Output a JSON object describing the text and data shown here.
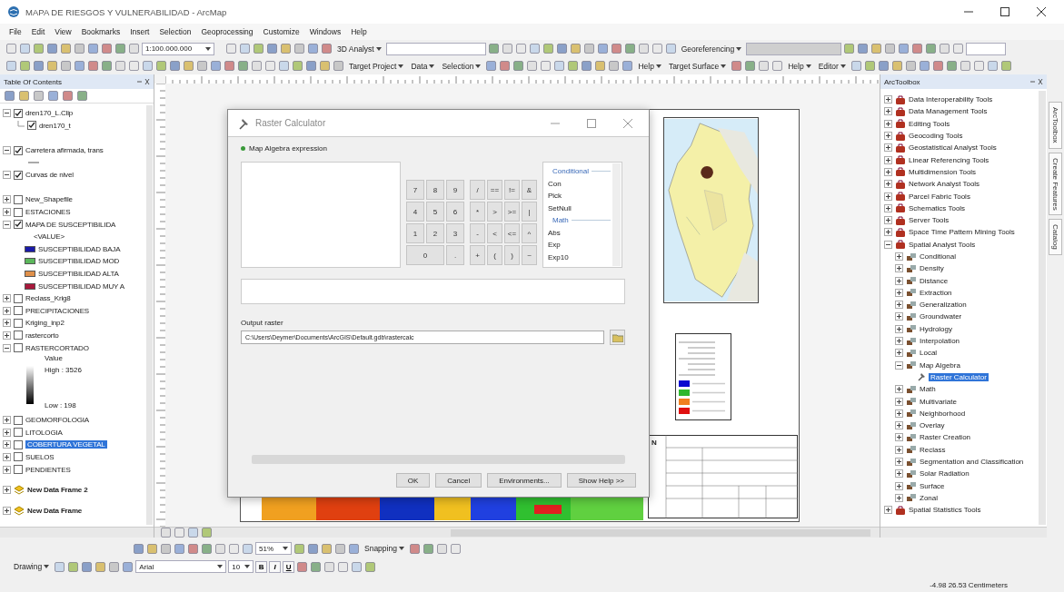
{
  "window": {
    "title": "MAPA DE RIESGOS Y VULNERABILIDAD - ArcMap"
  },
  "menu": [
    "File",
    "Edit",
    "View",
    "Bookmarks",
    "Insert",
    "Selection",
    "Geoprocessing",
    "Customize",
    "Windows",
    "Help"
  ],
  "toolbar_1": {
    "scale": "1:100.000.000",
    "analyst": "3D Analyst",
    "georeferencing": "Georeferencing"
  },
  "toolbar_2": [
    "Target Project",
    "Data",
    "Selection",
    "Help",
    "Target Surface",
    "Help",
    "Editor"
  ],
  "toc": {
    "title": "Table Of Contents",
    "layers": [
      {
        "kind": "layer",
        "label": "dren170_L.Clip",
        "checked": true,
        "expanded": true,
        "selected": false,
        "children": [
          {
            "kind": "layer",
            "label": "dren170_t",
            "checked": true,
            "selected": false
          }
        ]
      },
      {
        "kind": "layer",
        "label": "Carretera afirmada, trans",
        "checked": true,
        "expanded": true,
        "selected": false,
        "legend": [
          {
            "kind": "line"
          }
        ]
      },
      {
        "kind": "layer",
        "label": "Curvas de nivel",
        "checked": true,
        "expanded": true,
        "selected": false
      },
      {
        "kind": "layer",
        "label": "New_Shapefile",
        "checked": false,
        "expanded": false,
        "selected": false
      },
      {
        "kind": "layer",
        "label": "ESTACIONES",
        "checked": false,
        "expanded": false,
        "selected": false
      },
      {
        "kind": "layer",
        "label": "MAPA DE SUSCEPTIBILIDA",
        "checked": true,
        "expanded": true,
        "selected": false,
        "legend": [
          {
            "kind": "header",
            "label": "<VALUE>"
          },
          {
            "kind": "class",
            "label": "SUSCEPTIBILIDAD BAJA",
            "color": "#1a1aa8"
          },
          {
            "kind": "class",
            "label": "SUSCEPTIBILIDAD MOD",
            "color": "#5cb85c"
          },
          {
            "kind": "class",
            "label": "SUSCEPTIBILIDAD ALTA",
            "color": "#e0904a"
          },
          {
            "kind": "class",
            "label": "SUSCEPTIBILIDAD MUY A",
            "color": "#a8183c"
          }
        ]
      },
      {
        "kind": "layer",
        "label": "Reclass_Krig8",
        "checked": false,
        "expanded": false,
        "selected": false
      },
      {
        "kind": "layer",
        "label": "PRECIPITACIONES",
        "checked": false,
        "expanded": false,
        "selected": false
      },
      {
        "kind": "layer",
        "label": "Kriging_inp2",
        "checked": false,
        "expanded": false,
        "selected": false
      },
      {
        "kind": "layer",
        "label": "rastercorto",
        "checked": false,
        "expanded": false,
        "selected": false
      },
      {
        "kind": "layer",
        "label": "RASTERCORTADO",
        "checked": false,
        "expanded": true,
        "selected": false,
        "legend": [
          {
            "kind": "ramp",
            "label": "Value",
            "high": "High : 3526",
            "low": "Low : 198"
          }
        ]
      },
      {
        "kind": "layer",
        "label": "GEOMORFOLOGIA",
        "checked": false,
        "expanded": false,
        "selected": false
      },
      {
        "kind": "layer",
        "label": "LITOLOGIA",
        "checked": false,
        "expanded": false,
        "selected": false
      },
      {
        "kind": "layer",
        "label": "COBERTURA VEGETAL",
        "checked": false,
        "expanded": false,
        "selected": true
      },
      {
        "kind": "layer",
        "label": "SUELOS",
        "checked": false,
        "expanded": false,
        "selected": false
      },
      {
        "kind": "layer",
        "label": "PENDIENTES",
        "checked": false,
        "expanded": false,
        "selected": false
      },
      {
        "kind": "frame",
        "label": "New Data Frame 2",
        "expanded": false,
        "selected": false
      },
      {
        "kind": "frame",
        "label": "New Data Frame",
        "expanded": false,
        "selected": false
      }
    ]
  },
  "map_legend": {
    "north": "N"
  },
  "toolbox": {
    "title": "ArcToolbox",
    "items": [
      {
        "kind": "toolbox",
        "label": "Data Interoperability Tools",
        "expanded": false,
        "selected": false
      },
      {
        "kind": "toolbox",
        "label": "Data Management Tools",
        "expanded": false,
        "selected": false
      },
      {
        "kind": "toolbox",
        "label": "Editing Tools",
        "expanded": false,
        "selected": false
      },
      {
        "kind": "toolbox",
        "label": "Geocoding Tools",
        "expanded": false,
        "selected": false
      },
      {
        "kind": "toolbox",
        "label": "Geostatistical Analyst Tools",
        "expanded": false,
        "selected": false
      },
      {
        "kind": "toolbox",
        "label": "Linear Referencing Tools",
        "expanded": false,
        "selected": false
      },
      {
        "kind": "toolbox",
        "label": "Multidimension Tools",
        "expanded": false,
        "selected": false
      },
      {
        "kind": "toolbox",
        "label": "Network Analyst Tools",
        "expanded": false,
        "selected": false
      },
      {
        "kind": "toolbox",
        "label": "Parcel Fabric Tools",
        "expanded": false,
        "selected": false
      },
      {
        "kind": "toolbox",
        "label": "Schematics Tools",
        "expanded": false,
        "selected": false
      },
      {
        "kind": "toolbox",
        "label": "Server Tools",
        "expanded": false,
        "selected": false
      },
      {
        "kind": "toolbox",
        "label": "Space Time Pattern Mining Tools",
        "expanded": false,
        "selected": false
      },
      {
        "kind": "toolbox",
        "label": "Spatial Analyst Tools",
        "expanded": true,
        "selected": false,
        "children": [
          {
            "kind": "toolset",
            "label": "Conditional",
            "expanded": false,
            "selected": false
          },
          {
            "kind": "toolset",
            "label": "Density",
            "expanded": false,
            "selected": false
          },
          {
            "kind": "toolset",
            "label": "Distance",
            "expanded": false,
            "selected": false
          },
          {
            "kind": "toolset",
            "label": "Extraction",
            "expanded": false,
            "selected": false
          },
          {
            "kind": "toolset",
            "label": "Generalization",
            "expanded": false,
            "selected": false
          },
          {
            "kind": "toolset",
            "label": "Groundwater",
            "expanded": false,
            "selected": false
          },
          {
            "kind": "toolset",
            "label": "Hydrology",
            "expanded": false,
            "selected": false
          },
          {
            "kind": "toolset",
            "label": "Interpolation",
            "expanded": false,
            "selected": false
          },
          {
            "kind": "toolset",
            "label": "Local",
            "expanded": false,
            "selected": false
          },
          {
            "kind": "toolset",
            "label": "Map Algebra",
            "expanded": true,
            "selected": false,
            "children": [
              {
                "kind": "tool",
                "label": "Raster Calculator",
                "selected": true
              }
            ]
          },
          {
            "kind": "toolset",
            "label": "Math",
            "expanded": false,
            "selected": false
          },
          {
            "kind": "toolset",
            "label": "Multivariate",
            "expanded": false,
            "selected": false
          },
          {
            "kind": "toolset",
            "label": "Neighborhood",
            "expanded": false,
            "selected": false
          },
          {
            "kind": "toolset",
            "label": "Overlay",
            "expanded": false,
            "selected": false
          },
          {
            "kind": "toolset",
            "label": "Raster Creation",
            "expanded": false,
            "selected": false
          },
          {
            "kind": "toolset",
            "label": "Reclass",
            "expanded": false,
            "selected": false
          },
          {
            "kind": "toolset",
            "label": "Segmentation and Classification",
            "expanded": false,
            "selected": false
          },
          {
            "kind": "toolset",
            "label": "Solar Radiation",
            "expanded": false,
            "selected": false
          },
          {
            "kind": "toolset",
            "label": "Surface",
            "expanded": false,
            "selected": false
          },
          {
            "kind": "toolset",
            "label": "Zonal",
            "expanded": false,
            "selected": false
          }
        ]
      },
      {
        "kind": "toolbox",
        "label": "Spatial Statistics Tools",
        "expanded": false,
        "selected": false
      }
    ]
  },
  "side_tabs": [
    "ArcToolbox",
    "Create Features",
    "Catalog"
  ],
  "dialog": {
    "title": "Raster Calculator",
    "section": "Map Algebra expression",
    "number_keys": [
      [
        "7",
        "8",
        "9"
      ],
      [
        "4",
        "5",
        "6"
      ],
      [
        "1",
        "2",
        "3"
      ],
      [
        "0",
        "."
      ]
    ],
    "operator_keys": [
      [
        "/",
        "==",
        "!=",
        "&"
      ],
      [
        "*",
        ">",
        ">=",
        "|"
      ],
      [
        "-",
        "<",
        "<=",
        "^"
      ],
      [
        "+",
        "(",
        ")",
        "~"
      ]
    ],
    "functions": [
      {
        "kind": "header",
        "label": "Conditional"
      },
      {
        "kind": "item",
        "label": "Con"
      },
      {
        "kind": "item",
        "label": "Pick"
      },
      {
        "kind": "item",
        "label": "SetNull"
      },
      {
        "kind": "header",
        "label": "Math"
      },
      {
        "kind": "item",
        "label": "Abs"
      },
      {
        "kind": "item",
        "label": "Exp"
      },
      {
        "kind": "item",
        "label": "Exp10"
      }
    ],
    "output_label": "Output raster",
    "output_value": "C:\\Users\\Deymer\\Documents\\ArcGIS\\Default.gdb\\rastercalc",
    "buttons": [
      "OK",
      "Cancel",
      "Environments...",
      "Show Help >>"
    ]
  },
  "draw_toolbar": {
    "zoom": "51%",
    "snapping": "Snapping",
    "drawing": "Drawing",
    "font": "Arial",
    "size": "10",
    "styles": [
      "B",
      "I",
      "U"
    ]
  },
  "status": {
    "coordinates": "-4.98  26.53 Centimeters"
  }
}
